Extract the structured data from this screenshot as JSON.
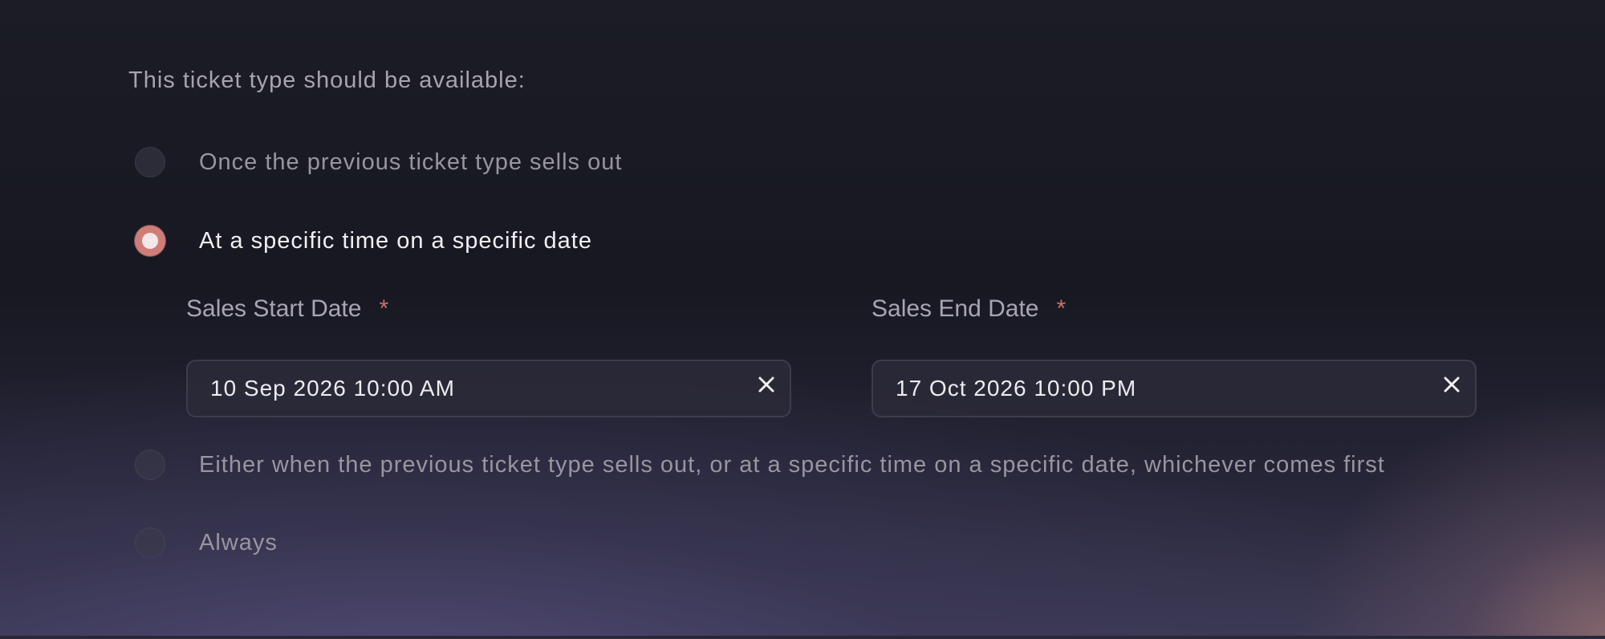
{
  "question": "This ticket type should be available:",
  "options": [
    {
      "label": "Once the previous ticket type sells out",
      "selected": false
    },
    {
      "label": "At a specific time on a specific date",
      "selected": true
    },
    {
      "label": "Either when the previous ticket type sells out, or at a specific time on a specific date, whichever comes first",
      "selected": false
    },
    {
      "label": "Always",
      "selected": false
    }
  ],
  "sales_start": {
    "label": "Sales Start Date",
    "required_mark": "*",
    "value": "10 Sep 2026 10:00 AM",
    "clear_icon": "close-icon"
  },
  "sales_end": {
    "label": "Sales End Date",
    "required_mark": "*",
    "value": "17 Oct 2026 10:00 PM",
    "clear_icon": "close-icon"
  },
  "colors": {
    "accent": "#d07d78",
    "required": "#c9716b",
    "selected_text": "#f1eff4",
    "muted_text": "#9995a0"
  }
}
